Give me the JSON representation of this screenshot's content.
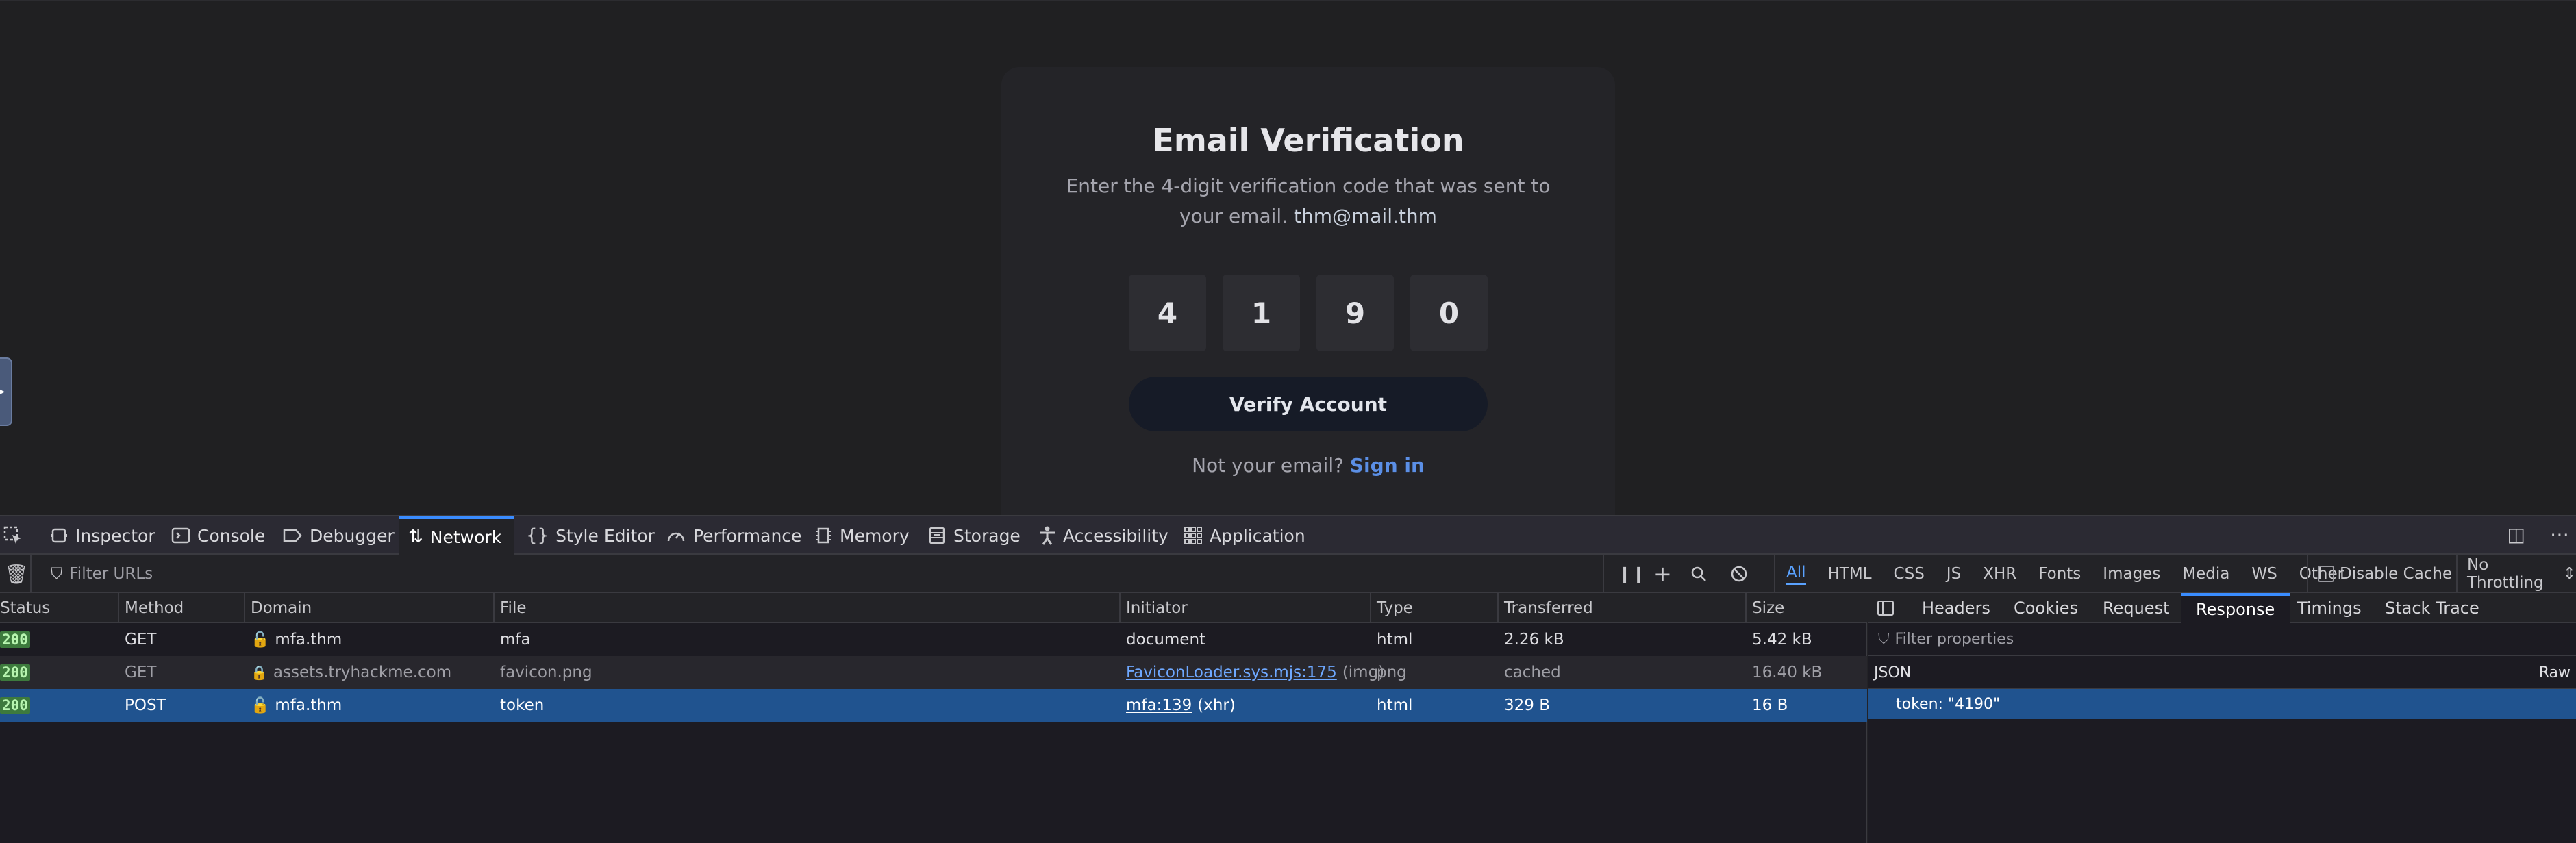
{
  "page": {
    "title": "Email Verification",
    "description": "Enter the 4-digit verification code that was sent to your email.",
    "email": "thm@mail.thm",
    "code_digits": [
      "4",
      "1",
      "9",
      "0"
    ],
    "verify_button": "Verify Account",
    "not_email_text": "Not your email?",
    "sign_in_link": "Sign in"
  },
  "devtools": {
    "tabs": [
      "Inspector",
      "Console",
      "Debugger",
      "Network",
      "Style Editor",
      "Performance",
      "Memory",
      "Storage",
      "Accessibility",
      "Application"
    ],
    "active_tab": "Network",
    "filter_placeholder": "Filter URLs",
    "type_filters": [
      "All",
      "HTML",
      "CSS",
      "JS",
      "XHR",
      "Fonts",
      "Images",
      "Media",
      "WS",
      "Other"
    ],
    "active_type_filter": "All",
    "disable_cache_label": "Disable Cache",
    "throttling": "No Throttling",
    "throttling_arrow": "⇕",
    "columns": [
      "Status",
      "Method",
      "Domain",
      "File",
      "Initiator",
      "Type",
      "Transferred",
      "Size"
    ],
    "requests": [
      {
        "status": "200",
        "method": "GET",
        "domain": "mfa.thm",
        "file": "mfa",
        "initiator": "document",
        "initiator_suffix": "",
        "type": "html",
        "transferred": "2.26 kB",
        "size": "5.42 kB"
      },
      {
        "status": "200",
        "method": "GET",
        "domain": "assets.tryhackme.com",
        "file": "favicon.png",
        "initiator": "FaviconLoader.sys.mjs:175",
        "initiator_suffix": "(img)",
        "type": "png",
        "transferred": "cached",
        "size": "16.40 kB"
      },
      {
        "status": "200",
        "method": "POST",
        "domain": "mfa.thm",
        "file": "token",
        "initiator": "mfa:139",
        "initiator_suffix": "(xhr)",
        "type": "html",
        "transferred": "329 B",
        "size": "16 B"
      }
    ],
    "response_tabs": [
      "Headers",
      "Cookies",
      "Request",
      "Response",
      "Timings",
      "Stack Trace"
    ],
    "active_response_tab": "Response",
    "filter_properties_placeholder": "Filter properties",
    "json_label": "JSON",
    "raw_label": "Raw",
    "token_line": "token: \"4190\""
  }
}
